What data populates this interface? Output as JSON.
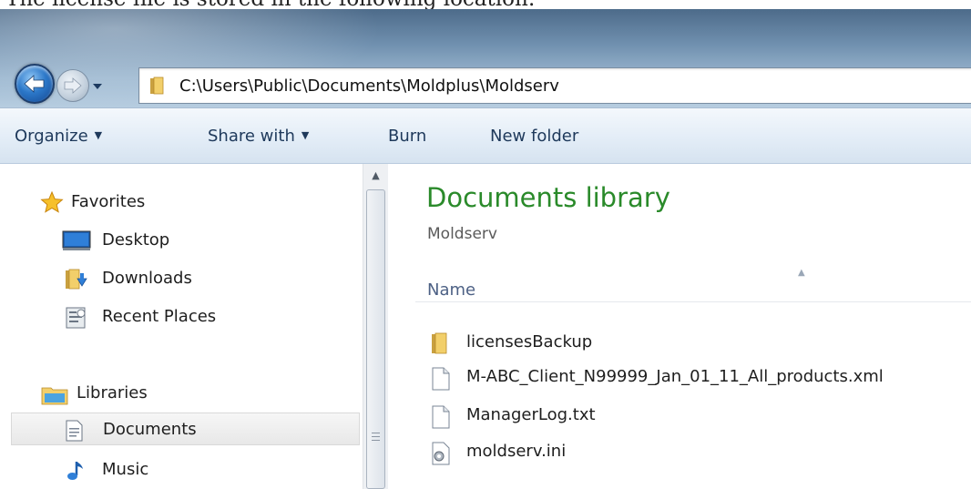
{
  "caption": "The license file is stored in the following location:",
  "address_bar": {
    "path": "C:\\Users\\Public\\Documents\\Moldplus\\Moldserv"
  },
  "command_bar": {
    "organize": "Organize",
    "share_with": "Share with",
    "burn": "Burn",
    "new_folder": "New folder"
  },
  "nav": {
    "favorites": "Favorites",
    "desktop": "Desktop",
    "downloads": "Downloads",
    "recent_places": "Recent Places",
    "libraries": "Libraries",
    "documents": "Documents",
    "music": "Music"
  },
  "content": {
    "title": "Documents library",
    "subtitle": "Moldserv",
    "column_name": "Name",
    "files": [
      {
        "name": "licensesBackup",
        "icon": "folder-icon"
      },
      {
        "name": "M-ABC_Client_N99999_Jan_01_11_All_products.xml",
        "icon": "xml-file-icon"
      },
      {
        "name": "ManagerLog.txt",
        "icon": "text-file-icon"
      },
      {
        "name": "moldserv.ini",
        "icon": "config-file-icon"
      }
    ]
  },
  "colors": {
    "library_title": "#2a8a2a",
    "command_text": "#1e395b",
    "column_header_text": "#4d6185"
  }
}
